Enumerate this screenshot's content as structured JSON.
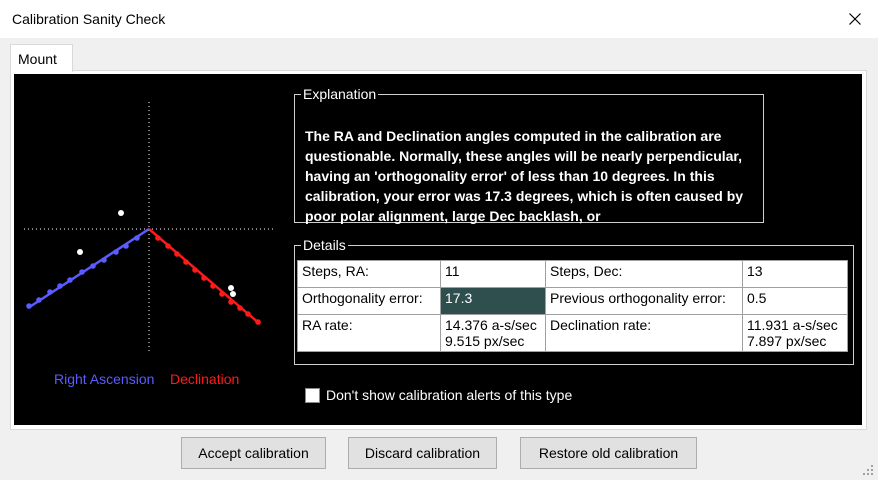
{
  "window": {
    "title": "Calibration Sanity Check"
  },
  "tabs": [
    {
      "label": "Mount"
    }
  ],
  "plot": {
    "legend_ra": "Right Ascension",
    "legend_dec": "Declination",
    "colors": {
      "ra": "#5b5bff",
      "dec": "#ff1a1a"
    }
  },
  "explanation": {
    "title": "Explanation",
    "text": "The RA and Declination angles computed in the calibration are questionable.  Normally, these angles will be nearly perpendicular, having an 'orthogonality error' of less than 10 degrees.  In this calibration, your error was 17.3 degrees, which is often caused by poor polar alignment, large Dec backlash, or"
  },
  "details": {
    "title": "Details",
    "rows": [
      {
        "l1": "Steps, RA:",
        "v1a": "11",
        "v1b": "",
        "l2": "Steps, Dec:",
        "v2a": "13",
        "v2b": ""
      },
      {
        "l1": "Orthogonality error:",
        "v1a": "17.3",
        "v1b": "",
        "l2": "Previous orthogonality error:",
        "v2a": "0.5",
        "v2b": ""
      },
      {
        "l1": "RA rate:",
        "v1a": "14.376 a-s/sec",
        "v1b": "9.515 px/sec",
        "l2": "Declination rate:",
        "v2a": "11.931 a-s/sec",
        "v2b": "7.897 px/sec"
      }
    ]
  },
  "checkbox": {
    "label": "Don't show calibration alerts of this type",
    "checked": false
  },
  "buttons": {
    "accept": "Accept calibration",
    "discard": "Discard calibration",
    "restore": "Restore old calibration"
  }
}
